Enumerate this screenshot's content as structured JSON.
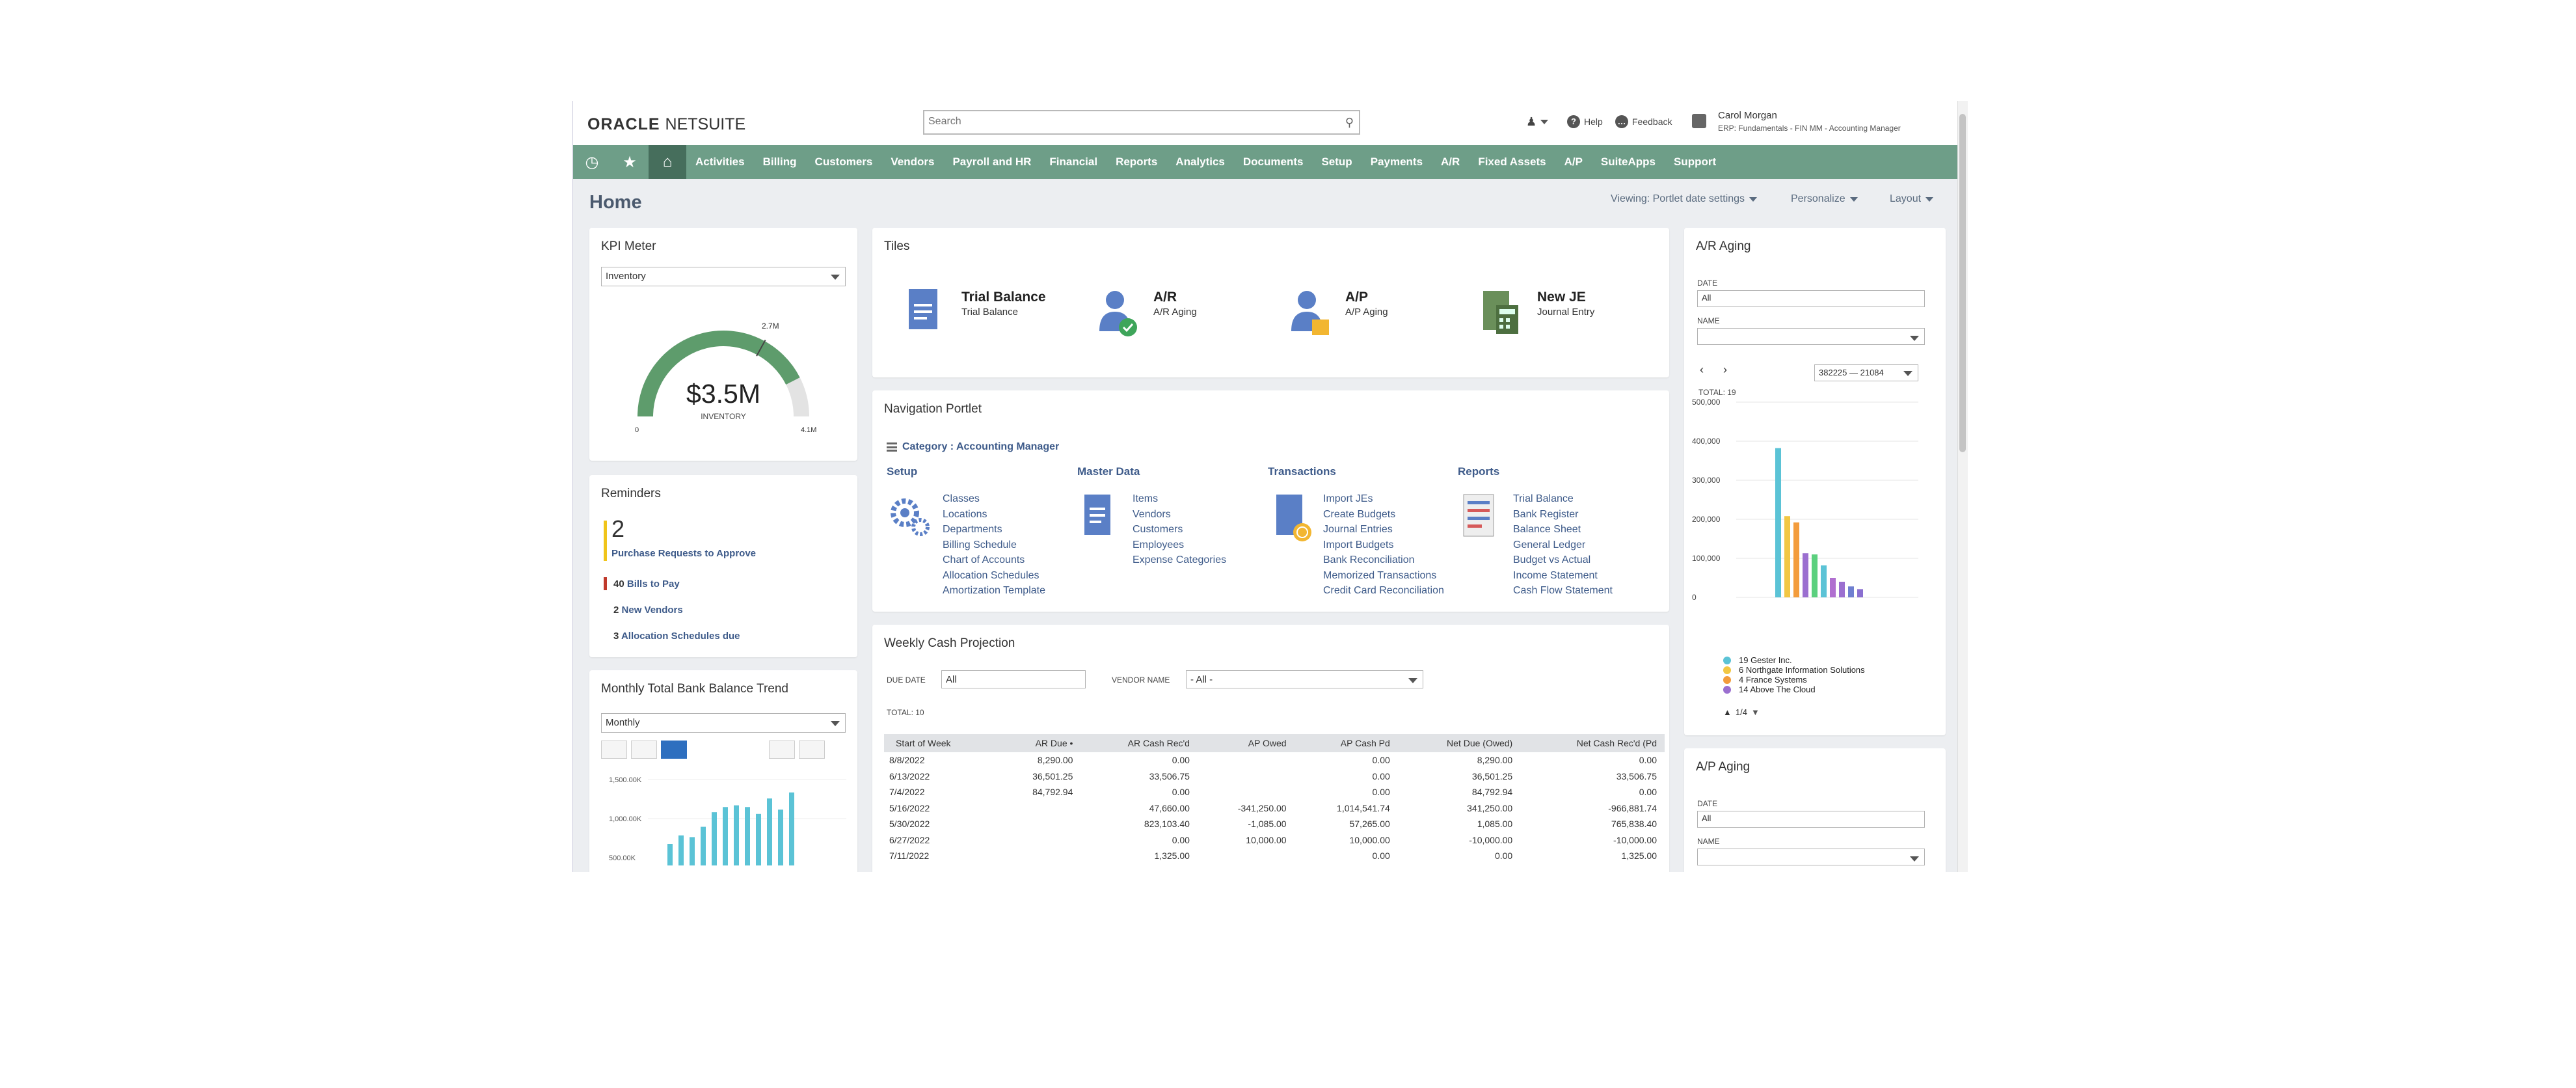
{
  "app": {
    "logo_oracle": "ORACLE",
    "logo_netsuite": "NETSUITE"
  },
  "header": {
    "search_placeholder": "Search",
    "help": "Help",
    "feedback": "Feedback",
    "user_name": "Carol Morgan",
    "user_role": "ERP: Fundamentals - FIN MM - Accounting Manager"
  },
  "nav": {
    "items": [
      "Activities",
      "Billing",
      "Customers",
      "Vendors",
      "Payroll and HR",
      "Financial",
      "Reports",
      "Analytics",
      "Documents",
      "Setup",
      "Payments",
      "A/R",
      "Fixed Assets",
      "A/P",
      "SuiteApps",
      "Support"
    ]
  },
  "page": {
    "title": "Home",
    "viewing": "Viewing: Portlet date settings",
    "personalize": "Personalize",
    "layout": "Layout"
  },
  "kpi": {
    "title": "KPI Meter",
    "select": "Inventory",
    "value": "$3.5M",
    "sub": "INVENTORY",
    "min": "0",
    "mark": "2.7M",
    "max": "4.1M",
    "fill_fraction": 0.85,
    "colors": {
      "fill": "#5e9c6c",
      "track": "#e3e3e3"
    }
  },
  "reminders": {
    "title": "Reminders",
    "main_count": "2",
    "main_label": "Purchase Requests to Approve",
    "items": [
      {
        "count": "40",
        "label": "Bills to Pay",
        "color": "#c0392b"
      },
      {
        "count": "2",
        "label": "New Vendors",
        "color": ""
      },
      {
        "count": "3",
        "label": "Allocation Schedules due",
        "color": ""
      }
    ]
  },
  "trend": {
    "title": "Monthly Total Bank Balance Trend",
    "select": "Monthly",
    "ticks": [
      "1,500.00K",
      "1,000.00K",
      "500.00K"
    ],
    "bars": [
      0.25,
      0.35,
      0.33,
      0.45,
      0.62,
      0.68,
      0.7,
      0.68,
      0.6,
      0.78,
      0.65,
      0.85
    ]
  },
  "tiles": {
    "title": "Tiles",
    "items": [
      {
        "title": "Trial Balance",
        "sub": "Trial Balance",
        "bg": "#f9ded9"
      },
      {
        "title": "A/R",
        "sub": "A/R Aging",
        "bg": "#fbdbe3"
      },
      {
        "title": "A/P",
        "sub": "A/P Aging",
        "bg": "#dcefd8"
      },
      {
        "title": "New JE",
        "sub": "Journal Entry",
        "bg": "#dce4ef"
      }
    ]
  },
  "navportlet": {
    "title": "Navigation Portlet",
    "category": "Category : Accounting Manager",
    "sections": [
      {
        "head": "Setup",
        "links": [
          "Classes",
          "Locations",
          "Departments",
          "Billing Schedule",
          "Chart of Accounts",
          "Allocation Schedules",
          "Amortization Template"
        ]
      },
      {
        "head": "Master Data",
        "links": [
          "Items",
          "Vendors",
          "Customers",
          "Employees",
          "Expense Categories"
        ]
      },
      {
        "head": "Transactions",
        "links": [
          "Import JEs",
          "Create Budgets",
          "Journal Entries",
          "Import Budgets",
          "Bank Reconciliation",
          "Memorized Transactions",
          "Credit Card Reconciliation"
        ]
      },
      {
        "head": "Reports",
        "links": [
          "Trial Balance",
          "Bank Register",
          "Balance Sheet",
          "General Ledger",
          "Budget vs Actual",
          "Income Statement",
          "Cash Flow Statement"
        ]
      }
    ]
  },
  "cash": {
    "title": "Weekly Cash Projection",
    "due_date_label": "DUE DATE",
    "due_date_value": "All",
    "vendor_label": "VENDOR NAME",
    "vendor_value": "- All -",
    "total": "TOTAL: 10",
    "columns": [
      "Start of Week",
      "AR Due •",
      "AR Cash Rec'd",
      "AP Owed",
      "AP Cash Pd",
      "Net Due (Owed)",
      "Net Cash Rec'd (Pd"
    ],
    "rows": [
      [
        "8/8/2022",
        "8,290.00",
        "0.00",
        "",
        "0.00",
        "8,290.00",
        "0.00"
      ],
      [
        "6/13/2022",
        "36,501.25",
        "33,506.75",
        "",
        "0.00",
        "36,501.25",
        "33,506.75"
      ],
      [
        "7/4/2022",
        "84,792.94",
        "0.00",
        "",
        "0.00",
        "84,792.94",
        "0.00"
      ],
      [
        "5/16/2022",
        "",
        "47,660.00",
        "-341,250.00",
        "1,014,541.74",
        "341,250.00",
        "-966,881.74"
      ],
      [
        "5/30/2022",
        "",
        "823,103.40",
        "-1,085.00",
        "57,265.00",
        "1,085.00",
        "765,838.40"
      ],
      [
        "6/27/2022",
        "",
        "0.00",
        "10,000.00",
        "10,000.00",
        "-10,000.00",
        "-10,000.00"
      ],
      [
        "7/11/2022",
        "",
        "1,325.00",
        "",
        "0.00",
        "0.00",
        "1,325.00"
      ]
    ]
  },
  "araging": {
    "title": "A/R Aging",
    "date_label": "DATE",
    "date_value": "All",
    "name_label": "NAME",
    "name_value": "",
    "range": "382225 — 21084",
    "total": "TOTAL: 19",
    "page": "1/4",
    "ticks": [
      "500,000",
      "400,000",
      "300,000",
      "200,000",
      "100,000",
      "0"
    ],
    "legend": [
      {
        "label": "19 Gester Inc.",
        "color": "#5bc3d6"
      },
      {
        "label": "6 Northgate Information Solutions",
        "color": "#f2c744"
      },
      {
        "label": "4 France Systems",
        "color": "#f39c3c"
      },
      {
        "label": "14 Above The Cloud",
        "color": "#9b6fd0"
      }
    ]
  },
  "apaging": {
    "title": "A/P Aging",
    "date_label": "DATE",
    "date_value": "All",
    "name_label": "NAME"
  },
  "chart_data": {
    "type": "bar",
    "title": "A/R Aging",
    "ylim": [
      0,
      500000
    ],
    "series": [
      {
        "name": "19 Gester Inc.",
        "values": [
          382225
        ]
      },
      {
        "name": "6 Northgate Information Solutions",
        "values": [
          208000
        ]
      },
      {
        "name": "4 France Systems",
        "values": [
          192000
        ]
      },
      {
        "name": "14 Above The Cloud",
        "values": [
          113000
        ]
      }
    ],
    "values": [
      382225,
      208000,
      192000,
      113000,
      110000,
      82000,
      50000,
      40000,
      28000,
      21084
    ],
    "colors": [
      "#5bc3d6",
      "#f2c744",
      "#f39c3c",
      "#9b6fd0",
      "#5bd07e",
      "#5bc3d6",
      "#b06fd0",
      "#9b6fd0",
      "#6f7fd0",
      "#8a6fd0"
    ]
  }
}
